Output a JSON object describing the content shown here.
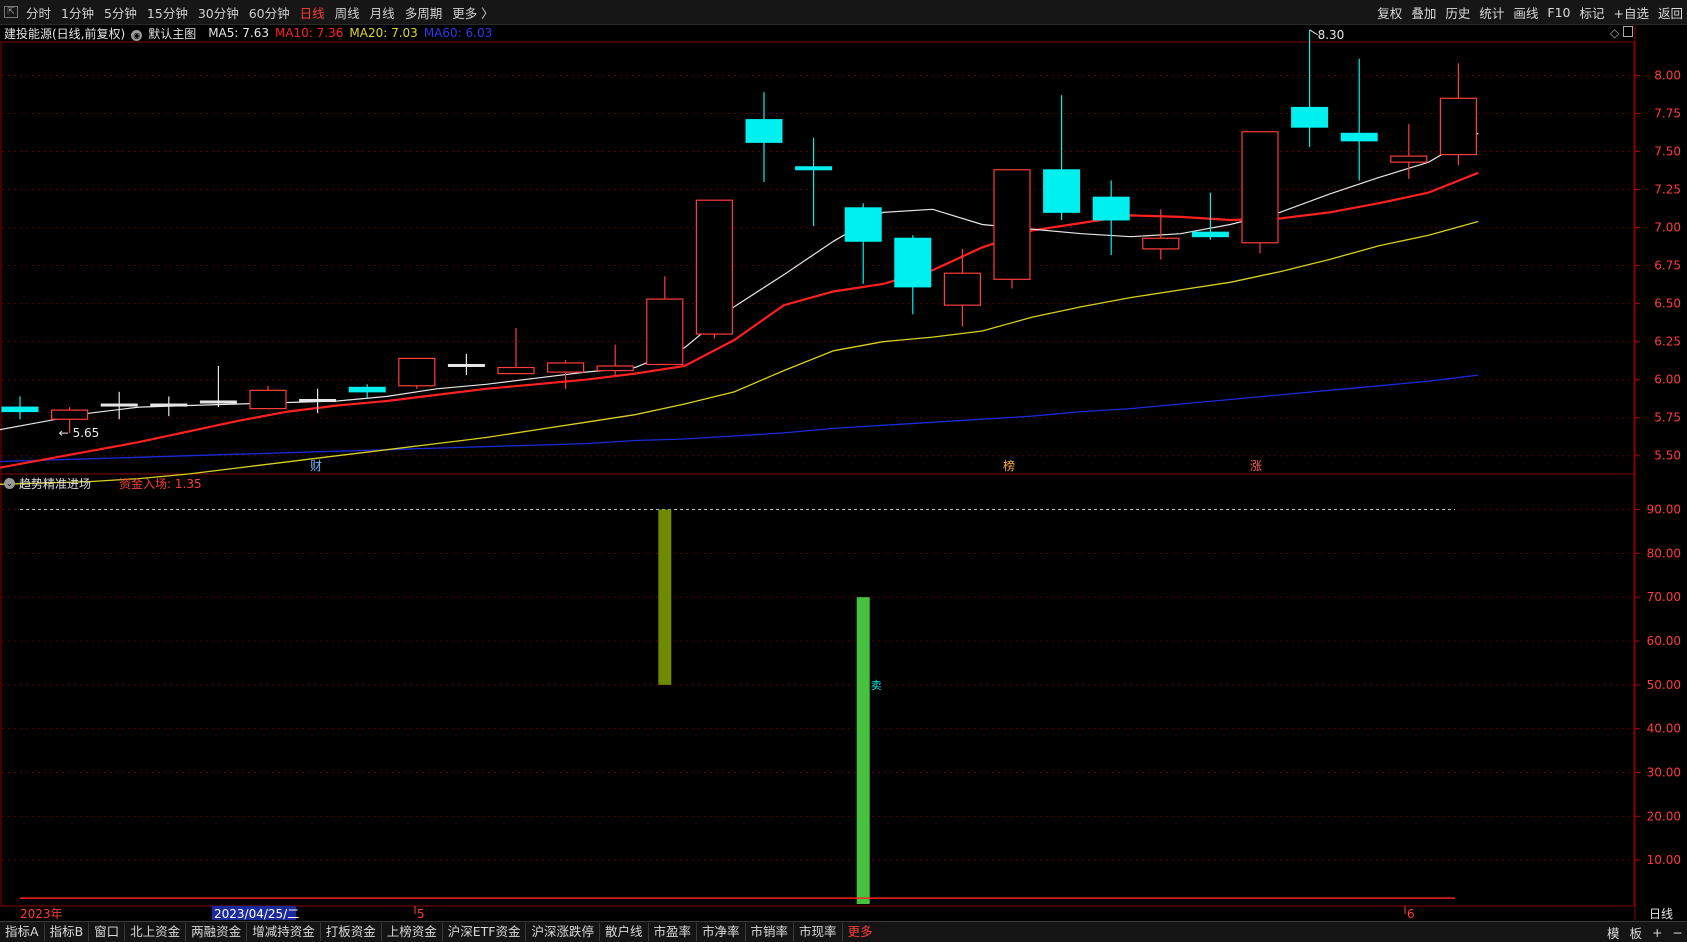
{
  "toolbar": {
    "periods": [
      "分时",
      "1分钟",
      "5分钟",
      "15分钟",
      "30分钟",
      "60分钟",
      "日线",
      "周线",
      "月线",
      "多周期",
      "更多 〉"
    ],
    "active_period": "日线",
    "tools": [
      "复权",
      "叠加",
      "历史",
      "统计",
      "画线",
      "F10",
      "标记",
      "+自选",
      "返回"
    ]
  },
  "info": {
    "stock": "建投能源(日线,前复权)",
    "main_chart": "默认主图",
    "ma5": "MA5: 7.63",
    "ma10": "MA10: 7.36",
    "ma20": "MA20: 7.03",
    "ma60": "MA60: 6.03"
  },
  "indicator": {
    "name": "趋势精准进场",
    "value": "资金入场: 1.35"
  },
  "axis": {
    "period_label": "日线",
    "date_start": "2023年",
    "date_cursor": "2023/04/25/二",
    "month_5": "5",
    "month_6": "6"
  },
  "annotations": {
    "high": "8.30",
    "low": "5.65",
    "event_cai": "财",
    "event_bang": "榜",
    "event_zhang": "涨",
    "sell_mark": "卖"
  },
  "bottom_tabs": [
    "指标A",
    "指标B",
    "窗口",
    "北上资金",
    "两融资金",
    "增减持资金",
    "打板资金",
    "上榜资金",
    "沪深ETF资金",
    "沪深涨跌停",
    "散户线",
    "市盈率",
    "市净率",
    "市销率",
    "市现率",
    "更多"
  ],
  "bottom_right": [
    "模",
    "板",
    "+",
    "−"
  ],
  "colors": {
    "up": "#ff3b3b",
    "down": "#00f0f0",
    "ma5": "#e6e6e6",
    "ma10": "#ff2020",
    "ma20": "#d8d020",
    "ma60": "#1a2ad8",
    "bar_olive": "#6e8a00",
    "bar_green": "#48c040"
  },
  "chart_data": [
    {
      "type": "candlestick",
      "title": "建投能源(日线,前复权)",
      "ylim": [
        5.38,
        8.22
      ],
      "y_ticks": [
        "8.00",
        "7.75",
        "7.50",
        "7.25",
        "7.00",
        "6.75",
        "6.50",
        "6.25",
        "6.00",
        "5.75",
        "5.50"
      ],
      "candles": [
        {
          "o": 5.82,
          "c": 5.79,
          "h": 5.89,
          "l": 5.74
        },
        {
          "o": 5.74,
          "c": 5.8,
          "h": 5.82,
          "l": 5.65
        },
        {
          "o": 5.84,
          "c": 5.84,
          "h": 5.92,
          "l": 5.74
        },
        {
          "o": 5.84,
          "c": 5.84,
          "h": 5.89,
          "l": 5.76
        },
        {
          "o": 5.86,
          "c": 5.86,
          "h": 6.09,
          "l": 5.82
        },
        {
          "o": 5.81,
          "c": 5.93,
          "h": 5.96,
          "l": 5.81
        },
        {
          "o": 5.87,
          "c": 5.87,
          "h": 5.94,
          "l": 5.78
        },
        {
          "o": 5.95,
          "c": 5.92,
          "h": 5.97,
          "l": 5.88
        },
        {
          "o": 5.96,
          "c": 6.14,
          "h": 6.14,
          "l": 5.94
        },
        {
          "o": 6.1,
          "c": 6.1,
          "h": 6.17,
          "l": 6.03
        },
        {
          "o": 6.04,
          "c": 6.08,
          "h": 6.34,
          "l": 6.04
        },
        {
          "o": 6.05,
          "c": 6.11,
          "h": 6.13,
          "l": 5.94
        },
        {
          "o": 6.06,
          "c": 6.09,
          "h": 6.23,
          "l": 6.03
        },
        {
          "o": 6.1,
          "c": 6.53,
          "h": 6.68,
          "l": 6.1
        },
        {
          "o": 6.3,
          "c": 7.18,
          "h": 7.18,
          "l": 6.27
        },
        {
          "o": 7.71,
          "c": 7.56,
          "h": 7.89,
          "l": 7.3
        },
        {
          "o": 7.4,
          "c": 7.38,
          "h": 7.59,
          "l": 7.01
        },
        {
          "o": 7.13,
          "c": 6.91,
          "h": 7.16,
          "l": 6.63
        },
        {
          "o": 6.93,
          "c": 6.61,
          "h": 6.95,
          "l": 6.43
        },
        {
          "o": 6.49,
          "c": 6.7,
          "h": 6.86,
          "l": 6.35
        },
        {
          "o": 6.66,
          "c": 7.38,
          "h": 7.38,
          "l": 6.6
        },
        {
          "o": 7.38,
          "c": 7.1,
          "h": 7.87,
          "l": 7.05
        },
        {
          "o": 7.2,
          "c": 7.05,
          "h": 7.31,
          "l": 6.82
        },
        {
          "o": 6.86,
          "c": 6.93,
          "h": 7.12,
          "l": 6.79
        },
        {
          "o": 6.97,
          "c": 6.94,
          "h": 7.23,
          "l": 6.92
        },
        {
          "o": 6.9,
          "c": 7.63,
          "h": 7.63,
          "l": 6.83
        },
        {
          "o": 7.79,
          "c": 7.66,
          "h": 8.3,
          "l": 7.53
        },
        {
          "o": 7.62,
          "c": 7.57,
          "h": 8.11,
          "l": 7.31
        },
        {
          "o": 7.43,
          "c": 7.47,
          "h": 7.68,
          "l": 7.32
        },
        {
          "o": 7.48,
          "c": 7.85,
          "h": 8.08,
          "l": 7.41
        }
      ],
      "ma5": [
        5.66,
        5.72,
        5.78,
        5.82,
        5.83,
        5.84,
        5.85,
        5.86,
        5.89,
        5.94,
        5.97,
        6.01,
        6.05,
        6.08,
        6.21,
        6.48,
        6.69,
        6.91,
        7.1,
        7.12,
        7.02,
        6.99,
        6.96,
        6.94,
        6.96,
        7.02,
        7.1,
        7.22,
        7.33,
        7.43,
        7.62
      ],
      "ma10": [
        5.41,
        5.47,
        5.53,
        5.59,
        5.66,
        5.73,
        5.79,
        5.83,
        5.86,
        5.9,
        5.94,
        5.97,
        6.0,
        6.04,
        6.09,
        6.26,
        6.49,
        6.58,
        6.63,
        6.72,
        6.87,
        6.98,
        7.03,
        7.08,
        7.07,
        7.05,
        7.06,
        7.1,
        7.16,
        7.23,
        7.36
      ],
      "ma20": [
        5.31,
        5.32,
        5.33,
        5.35,
        5.38,
        5.42,
        5.46,
        5.5,
        5.54,
        5.58,
        5.62,
        5.67,
        5.72,
        5.77,
        5.84,
        5.92,
        6.06,
        6.19,
        6.25,
        6.28,
        6.32,
        6.41,
        6.48,
        6.54,
        6.59,
        6.64,
        6.71,
        6.79,
        6.88,
        6.95,
        7.04
      ],
      "ma60": [
        5.46,
        5.47,
        5.48,
        5.49,
        5.5,
        5.51,
        5.52,
        5.53,
        5.54,
        5.55,
        5.56,
        5.57,
        5.58,
        5.6,
        5.61,
        5.63,
        5.65,
        5.68,
        5.7,
        5.72,
        5.74,
        5.76,
        5.79,
        5.81,
        5.84,
        5.87,
        5.9,
        5.93,
        5.96,
        5.99,
        6.03
      ]
    },
    {
      "type": "bar",
      "title": "趋势精准进场",
      "ylim": [
        0,
        94
      ],
      "y_ticks": [
        "90.00",
        "80.00",
        "70.00",
        "60.00",
        "50.00",
        "40.00",
        "30.00",
        "20.00",
        "10.00"
      ],
      "reference_line": 90,
      "bars": [
        {
          "index": 13,
          "from": 50,
          "to": 90
        },
        {
          "index": 17,
          "from": 0,
          "to": 70
        }
      ],
      "line_value": 1.35
    }
  ]
}
